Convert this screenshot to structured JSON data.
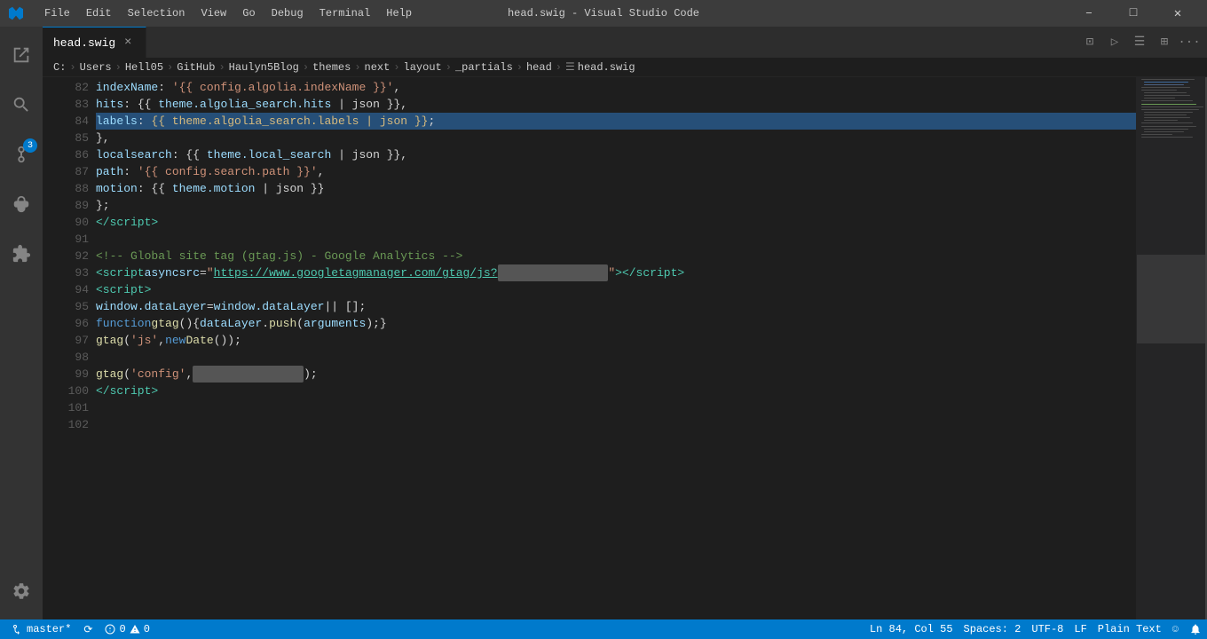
{
  "titlebar": {
    "title": "head.swig - Visual Studio Code",
    "menu_items": [
      "File",
      "Edit",
      "Selection",
      "View",
      "Go",
      "Debug",
      "Terminal",
      "Help"
    ]
  },
  "tab": {
    "filename": "head.swig",
    "close_label": "×"
  },
  "breadcrumb": {
    "items": [
      "C:",
      "Users",
      "Hell05",
      "GitHub",
      "Haulyn5Blog",
      "themes",
      "next",
      "layout",
      "_partials",
      "head",
      "head.swig"
    ]
  },
  "code": {
    "lines": [
      {
        "num": "82",
        "content_html": "            <span class='c-attr'>indexName</span><span class='c-punct'>: </span><span class='c-string'>&#39;{{ config.algolia.indexName }}&#39;</span><span class='c-punct'>,</span>"
      },
      {
        "num": "83",
        "content_html": "            <span class='c-attr'>hits</span><span class='c-punct'>: {{ </span><span class='c-attr'>theme.algolia_search.hits</span><span class='c-punct'> | json }},</span>"
      },
      {
        "num": "84",
        "content_html": "            <span class='c-attr'>labels</span><span class='c-punct'>: </span><span class='c-template'>{{ theme.algolia_search.labels | json }}</span><span class='c-punct'>;</span>",
        "highlight": true
      },
      {
        "num": "85",
        "content_html": "        <span class='c-punct'>},</span>"
      },
      {
        "num": "86",
        "content_html": "        <span class='c-attr'>localsearch</span><span class='c-punct'>: {{ </span><span class='c-attr'>theme.local_search</span><span class='c-punct'> | json }},</span>"
      },
      {
        "num": "87",
        "content_html": "        <span class='c-attr'>path</span><span class='c-punct'>: </span><span class='c-string'>&#39;{{ config.search.path }}&#39;</span><span class='c-punct'>,</span>"
      },
      {
        "num": "88",
        "content_html": "        <span class='c-attr'>motion</span><span class='c-punct'>: {{ </span><span class='c-attr'>theme.motion</span><span class='c-punct'> | json }}</span>"
      },
      {
        "num": "89",
        "content_html": "    <span class='c-punct'>};</span>"
      },
      {
        "num": "90",
        "content_html": "<span class='c-tag'>&lt;/script&gt;</span>"
      },
      {
        "num": "91",
        "content_html": ""
      },
      {
        "num": "92",
        "content_html": "<span class='c-comment'>&lt;!-- Global site tag (gtag.js) - Google Analytics --&gt;</span>"
      },
      {
        "num": "93",
        "content_html": "<span class='c-tag'>&lt;script</span> <span class='c-attr'>async</span> <span class='c-attr'>src</span><span class='c-punct'>=</span><span class='c-string'>&#34;<span class='c-url'>https://www.googletagmanager.com/gtag/js?</span><span class='c-redacted'>&#160;&#160;&#160;&#160;&#160;&#160;&#160;&#160;&#160;&#160;&#160;&#160;&#160;&#160;&#160;&#160;</span>&#34;</span><span class='c-tag'>&gt;&lt;/script&gt;</span>"
      },
      {
        "num": "94",
        "content_html": "<span class='c-tag'>&lt;script&gt;</span>"
      },
      {
        "num": "95",
        "content_html": "  <span class='c-attr'>window.dataLayer</span> <span class='c-punct'>=</span> <span class='c-attr'>window.dataLayer</span> <span class='c-punct'>|| [];</span>"
      },
      {
        "num": "96",
        "content_html": "  <span class='c-keyword'>function</span> <span class='c-func'>gtag</span><span class='c-punct'>(){</span><span class='c-attr'>dataLayer</span><span class='c-punct'>.</span><span class='c-func'>push</span><span class='c-punct'>(</span><span class='c-attr'>arguments</span><span class='c-punct'>);}</span>"
      },
      {
        "num": "97",
        "content_html": "  <span class='c-func'>gtag</span><span class='c-punct'>(</span><span class='c-string'>&#39;js&#39;</span><span class='c-punct'>,</span> <span class='c-keyword'>new</span> <span class='c-func'>Date</span><span class='c-punct'>());</span>"
      },
      {
        "num": "98",
        "content_html": ""
      },
      {
        "num": "99",
        "content_html": "  <span class='c-func'>gtag</span><span class='c-punct'>(</span><span class='c-string'>&#39;config&#39;</span><span class='c-punct'>,</span> <span class='c-redacted'>&#160;&#160;&#160;&#160;&#160;&#160;&#160;&#160;&#160;&#160;&#160;&#160;&#160;&#160;&#160;&#160;</span><span class='c-punct'>);</span>"
      },
      {
        "num": "100",
        "content_html": "<span class='c-tag'>&lt;/script&gt;</span>"
      },
      {
        "num": "101",
        "content_html": ""
      },
      {
        "num": "102",
        "content_html": ""
      }
    ]
  },
  "status_bar": {
    "branch": "master*",
    "sync_icon": "⟳",
    "errors": "0",
    "warnings": "0",
    "ln": "Ln 84,",
    "col": "Col 55",
    "spaces": "Spaces: 2",
    "encoding": "UTF-8",
    "eol": "LF",
    "language": "Plain Text",
    "feedback_icon": "☺",
    "bell_icon": "🔔"
  },
  "activity_bar": {
    "items": [
      {
        "name": "explorer",
        "icon": "☰"
      },
      {
        "name": "search",
        "icon": "🔍"
      },
      {
        "name": "source-control",
        "icon": "⎇",
        "badge": "3"
      },
      {
        "name": "debug",
        "icon": "🐛"
      },
      {
        "name": "extensions",
        "icon": "⊞"
      }
    ],
    "bottom_items": [
      {
        "name": "settings",
        "icon": "⚙"
      }
    ]
  },
  "tabs_actions": {
    "split": "⊡",
    "run": "▷",
    "viewer": "☰",
    "layout": "⊞",
    "more": "···"
  }
}
